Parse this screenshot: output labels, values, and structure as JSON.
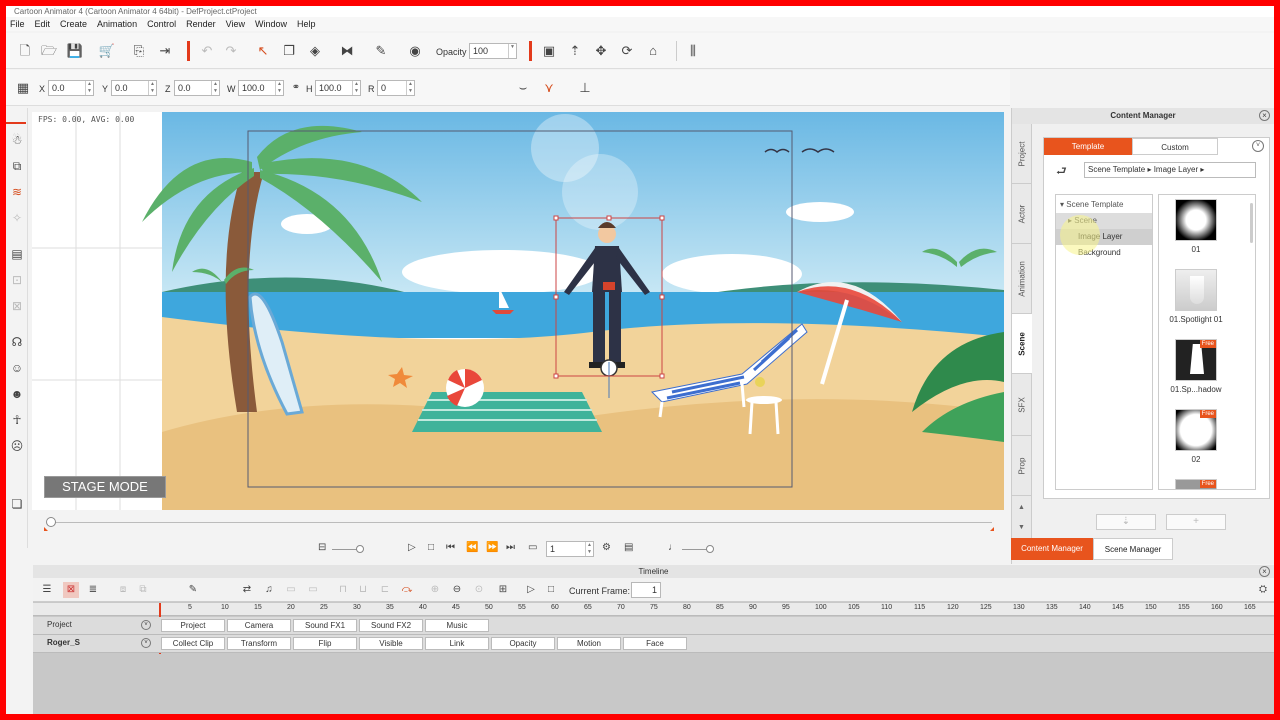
{
  "window": {
    "title": "Cartoon Animator 4 (Cartoon Animator 4 64bit) - DefProject.ctProject"
  },
  "menu": [
    "File",
    "Edit",
    "Create",
    "Animation",
    "Control",
    "Render",
    "View",
    "Window",
    "Help"
  ],
  "toolbar": {
    "opacity_label": "Opacity :",
    "opacity_value": "100"
  },
  "transform": {
    "x_label": "X",
    "x_value": "0.0",
    "y_label": "Y",
    "y_value": "0.0",
    "z_label": "Z",
    "z_value": "0.0",
    "w_label": "W",
    "w_value": "100.0",
    "h_label": "H",
    "h_value": "100.0",
    "r_label": "R",
    "r_value": "0"
  },
  "viewport": {
    "fps_text": "FPS: 0.00, AVG: 0.00",
    "stage_mode_label": "STAGE MODE"
  },
  "playback": {
    "frame_value": "1"
  },
  "content_manager": {
    "title": "Content Manager",
    "vertical_tabs": [
      "Project",
      "Actor",
      "Animation",
      "Scene",
      "SFX",
      "Prop"
    ],
    "active_vertical_tab": "Scene",
    "tabs": {
      "template": "Template",
      "custom": "Custom"
    },
    "breadcrumb": [
      "Scene Template",
      "Image Layer"
    ],
    "tree": {
      "root": "Scene Template",
      "items": [
        "Scene",
        "Image Layer",
        "Background"
      ]
    },
    "thumbnails": [
      {
        "label": "01",
        "badge": ""
      },
      {
        "label": "01.Spotlight 01",
        "badge": ""
      },
      {
        "label": "01.Sp...hadow",
        "badge": "Free"
      },
      {
        "label": "02",
        "badge": "Free"
      },
      {
        "label": "",
        "badge": "Free"
      }
    ],
    "bottom_tabs": {
      "content_manager": "Content Manager",
      "scene_manager": "Scene Manager"
    }
  },
  "timeline": {
    "title": "Timeline",
    "current_frame_label": "Current Frame:",
    "current_frame_value": "1",
    "ruler": [
      "5",
      "10",
      "15",
      "20",
      "25",
      "30",
      "35",
      "40",
      "45",
      "50",
      "55",
      "60",
      "65",
      "70",
      "75",
      "80",
      "85",
      "90",
      "95",
      "100",
      "105",
      "110",
      "115",
      "120",
      "125",
      "130",
      "135",
      "140",
      "145",
      "150",
      "155",
      "160",
      "165"
    ],
    "tracks": [
      {
        "name": "Project",
        "buttons": [
          "Project",
          "Camera",
          "Sound FX1",
          "Sound FX2",
          "Music"
        ]
      },
      {
        "name": "Roger_S",
        "buttons": [
          "Collect Clip",
          "Transform",
          "Flip",
          "Visible",
          "Link",
          "Opacity",
          "Motion",
          "Face"
        ]
      }
    ]
  },
  "colors": {
    "accent": "#e8541d",
    "frame_border": "#ff0000"
  }
}
